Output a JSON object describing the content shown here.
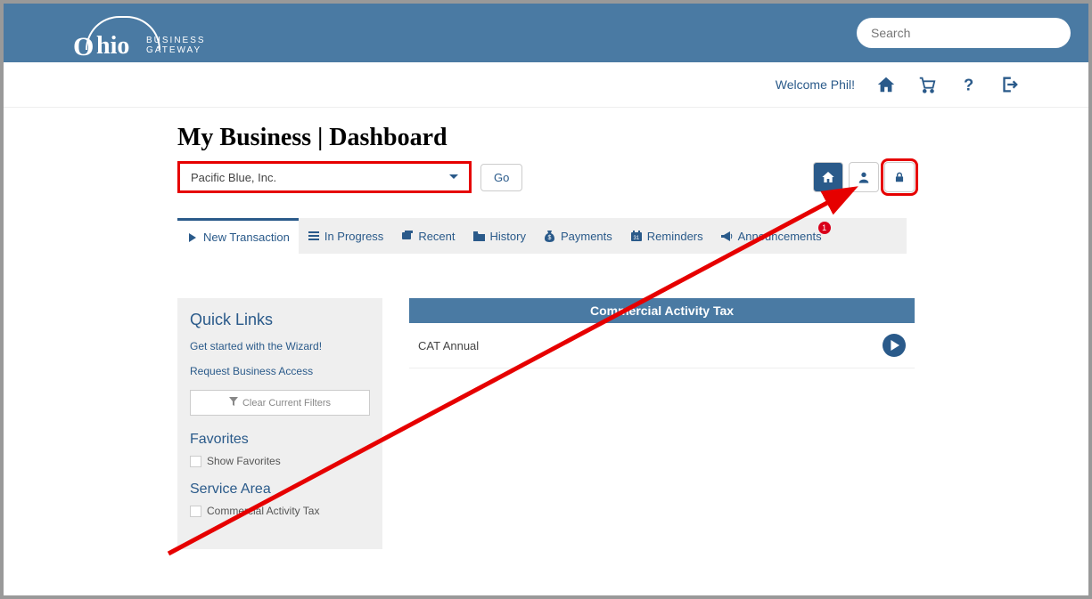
{
  "header": {
    "logo_text": "hio",
    "logo_sub1": "BUSINESS",
    "logo_sub2": "GATEWAY",
    "search_placeholder": "Search"
  },
  "welcome": {
    "text": "Welcome Phil!"
  },
  "page": {
    "title": "My Business  |  Dashboard",
    "business_selected": "Pacific Blue, Inc.",
    "go_label": "Go"
  },
  "tabs": {
    "new_transaction": "New Transaction",
    "in_progress": "In Progress",
    "recent": "Recent",
    "history": "History",
    "payments": "Payments",
    "reminders": "Reminders",
    "announcements": "Announcements",
    "announcements_badge": "1"
  },
  "sidebar": {
    "quick_links_title": "Quick Links",
    "wizard_link": "Get started with the Wizard!",
    "request_access": "Request Business Access",
    "clear_filters": "Clear Current Filters",
    "favorites_title": "Favorites",
    "show_favorites": "Show Favorites",
    "service_area_title": "Service Area",
    "service_area_item": "Commercial Activity Tax"
  },
  "main": {
    "section_header": "Commercial Activity Tax",
    "row_label": "CAT Annual"
  }
}
